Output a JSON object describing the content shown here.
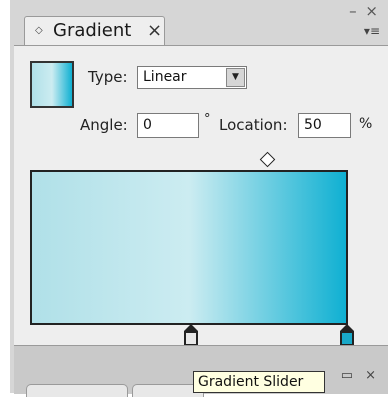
{
  "panel": {
    "title": "Gradient",
    "close_glyph": "×",
    "tab_grip_glyph": "◇",
    "window_controls": "– ×",
    "menu_glyph": "▾≡"
  },
  "controls": {
    "type_label": "Type:",
    "type_value": "Linear",
    "angle_label": "Angle:",
    "angle_value": "0",
    "degree_symbol": "°",
    "location_label": "Location:",
    "location_value": "50",
    "percent_symbol": "%"
  },
  "gradient": {
    "start_color": "#b0e0e8",
    "midpoint_color": "#ccecf1",
    "end_color": "#0fb0d2",
    "midpoint_location": 0.5,
    "stops": [
      {
        "location": 0.5,
        "color": "#e8e8e8"
      },
      {
        "location": 1.0,
        "color": "#19a8c8"
      }
    ]
  },
  "bottom_bar": {
    "controls": "▭ ×"
  },
  "tooltip": {
    "text": "Gradient Slider"
  }
}
